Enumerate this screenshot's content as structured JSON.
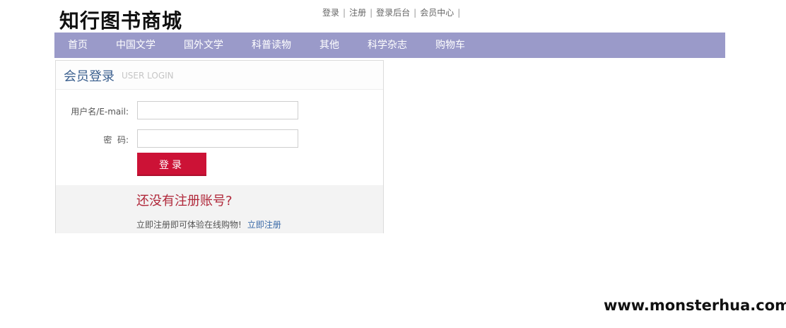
{
  "site": {
    "logo": "知行图书商城"
  },
  "toplinks": {
    "login": "登录",
    "register": "注册",
    "admin_login": "登录后台",
    "member_center": "会员中心",
    "separator": "|"
  },
  "nav": {
    "items": [
      "首页",
      "中国文学",
      "国外文学",
      "科普读物",
      "其他",
      "科学杂志",
      "购物车"
    ]
  },
  "login": {
    "title": "会员登录",
    "subtitle": "USER LOGIN",
    "username_label": "用户名/E-mail:",
    "username_value": "",
    "password_label": "密  码:",
    "password_value": "",
    "submit_label": "登录",
    "no_account_title": "还没有注册账号?",
    "no_account_text": "立即注册即可体验在线购物!",
    "register_link": "立即注册"
  },
  "watermark": "www.monsterhua.com",
  "colors": {
    "nav_bg": "#9a9ac9",
    "submit_bg": "#cc1236",
    "title_blue": "#3a5f8e",
    "foot_title_red": "#b0283a",
    "link_blue": "#3a6aa8"
  }
}
